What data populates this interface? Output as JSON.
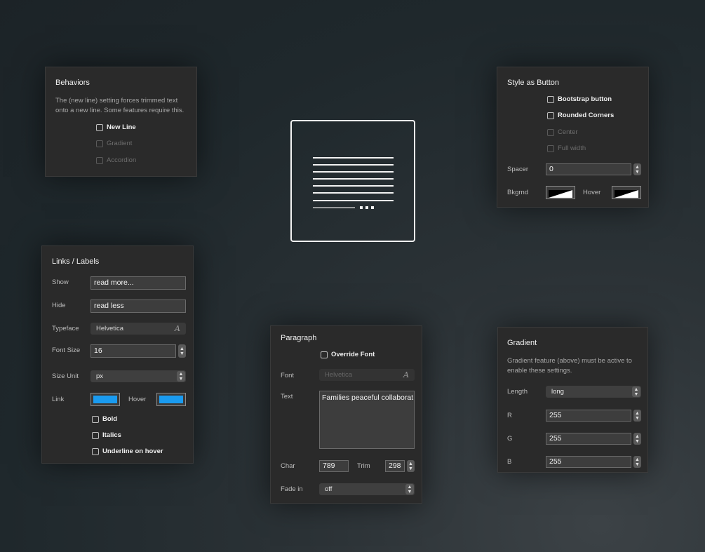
{
  "behaviors": {
    "title": "Behaviors",
    "description": "The (new line) setting forces trimmed text onto a new line. Some features require this.",
    "options": [
      "New Line",
      "Gradient",
      "Accordion"
    ]
  },
  "style_button": {
    "title": "Style as Button",
    "options": [
      "Bootstrap button",
      "Rounded Corners",
      "Center",
      "Full width"
    ],
    "spacer_label": "Spacer",
    "spacer_value": "0",
    "bkgrnd_label": "Bkgrnd",
    "hover_label": "Hover"
  },
  "links": {
    "title": "Links / Labels",
    "show_label": "Show",
    "show_value": "read more...",
    "hide_label": "Hide",
    "hide_value": "read less",
    "typeface_label": "Typeface",
    "typeface_value": "Helvetica",
    "font_size_label": "Font Size",
    "font_size_value": "16",
    "size_unit_label": "Size Unit",
    "size_unit_value": "px",
    "link_label": "Link",
    "hover_label": "Hover",
    "link_color": "#1a9bf0",
    "hover_color": "#1a9bf0",
    "options": [
      "Bold",
      "Italics",
      "Underline on hover"
    ]
  },
  "paragraph": {
    "title": "Paragraph",
    "override_label": "Override Font",
    "font_label": "Font",
    "font_value": "Helvetica",
    "text_label": "Text",
    "text_value": "Families peaceful collaborat",
    "char_label": "Char",
    "char_value": "789",
    "trim_label": "Trim",
    "trim_value": "298",
    "fade_label": "Fade in",
    "fade_value": "off"
  },
  "gradient": {
    "title": "Gradient",
    "description": "Gradient feature (above) must be active to enable these settings.",
    "length_label": "Length",
    "length_value": "long",
    "r_label": "R",
    "r_value": "255",
    "g_label": "G",
    "g_value": "255",
    "b_label": "B",
    "b_value": "255"
  },
  "icons": {
    "font_icon": "A",
    "stepper_up": "▲",
    "stepper_down": "▼"
  }
}
